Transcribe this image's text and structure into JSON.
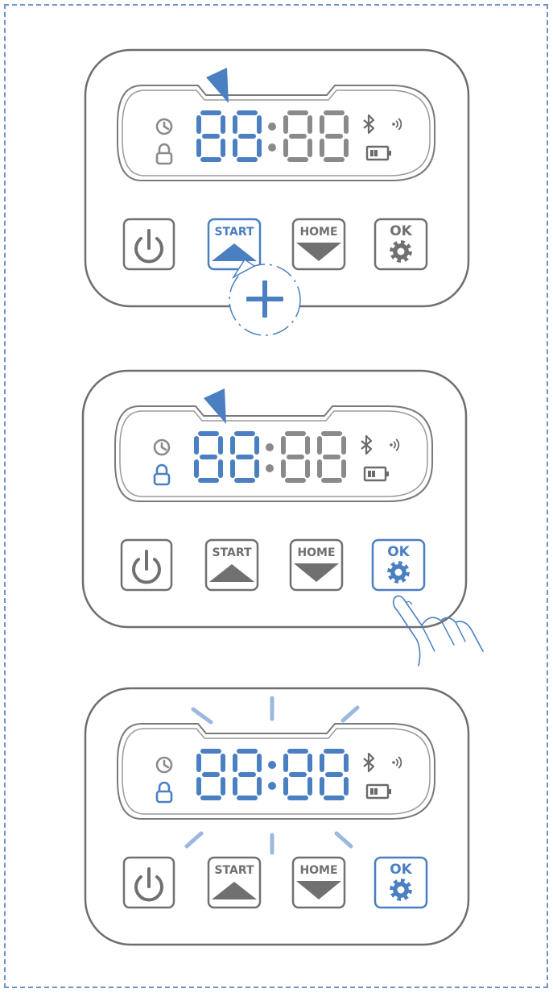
{
  "colors": {
    "accent": "#4a7fc1",
    "accent_light": "#9db8e0",
    "outline": "#707070",
    "segment_off": "#8a8a8a",
    "frame_border": "#6f93c4",
    "background": "#ffffff"
  },
  "panels": [
    {
      "display": {
        "digits": "88:88",
        "left_pair_highlighted": true,
        "right_pair_highlighted": false,
        "clock_icon": "clock-icon",
        "lock_icon": "lock-icon",
        "lock_highlighted": false,
        "bluetooth_icon": "bluetooth-icon",
        "signal_icon": "signal-icon",
        "battery_icon": "battery-icon"
      },
      "pointer_arrow": true,
      "flash_rays": false,
      "buttons": [
        {
          "id": "power",
          "label": "",
          "icon": "power-icon",
          "highlighted": false
        },
        {
          "id": "start",
          "label": "START",
          "icon": "triangle-up-icon",
          "highlighted": true
        },
        {
          "id": "home",
          "label": "HOME",
          "icon": "triangle-down-icon",
          "highlighted": false
        },
        {
          "id": "ok",
          "label": "OK",
          "icon": "gear-icon",
          "highlighted": false
        }
      ],
      "callout": {
        "icon": "plus-icon"
      },
      "hand": false
    },
    {
      "display": {
        "digits": "88:88",
        "left_pair_highlighted": true,
        "right_pair_highlighted": false,
        "clock_icon": "clock-icon",
        "lock_icon": "lock-icon",
        "lock_highlighted": true,
        "bluetooth_icon": "bluetooth-icon",
        "signal_icon": "signal-icon",
        "battery_icon": "battery-icon"
      },
      "pointer_arrow": true,
      "flash_rays": false,
      "buttons": [
        {
          "id": "power",
          "label": "",
          "icon": "power-icon",
          "highlighted": false
        },
        {
          "id": "start",
          "label": "START",
          "icon": "triangle-up-icon",
          "highlighted": false
        },
        {
          "id": "home",
          "label": "HOME",
          "icon": "triangle-down-icon",
          "highlighted": false
        },
        {
          "id": "ok",
          "label": "OK",
          "icon": "gear-icon",
          "highlighted": true
        }
      ],
      "callout": null,
      "hand": true
    },
    {
      "display": {
        "digits": "88:88",
        "left_pair_highlighted": true,
        "right_pair_highlighted": true,
        "clock_icon": "clock-icon",
        "lock_icon": "lock-icon",
        "lock_highlighted": true,
        "bluetooth_icon": "bluetooth-icon",
        "signal_icon": "signal-icon",
        "battery_icon": "battery-icon"
      },
      "pointer_arrow": false,
      "flash_rays": true,
      "buttons": [
        {
          "id": "power",
          "label": "",
          "icon": "power-icon",
          "highlighted": false
        },
        {
          "id": "start",
          "label": "START",
          "icon": "triangle-up-icon",
          "highlighted": false
        },
        {
          "id": "home",
          "label": "HOME",
          "icon": "triangle-down-icon",
          "highlighted": false
        },
        {
          "id": "ok",
          "label": "OK",
          "icon": "gear-icon",
          "highlighted": true
        }
      ],
      "callout": null,
      "hand": false
    }
  ]
}
